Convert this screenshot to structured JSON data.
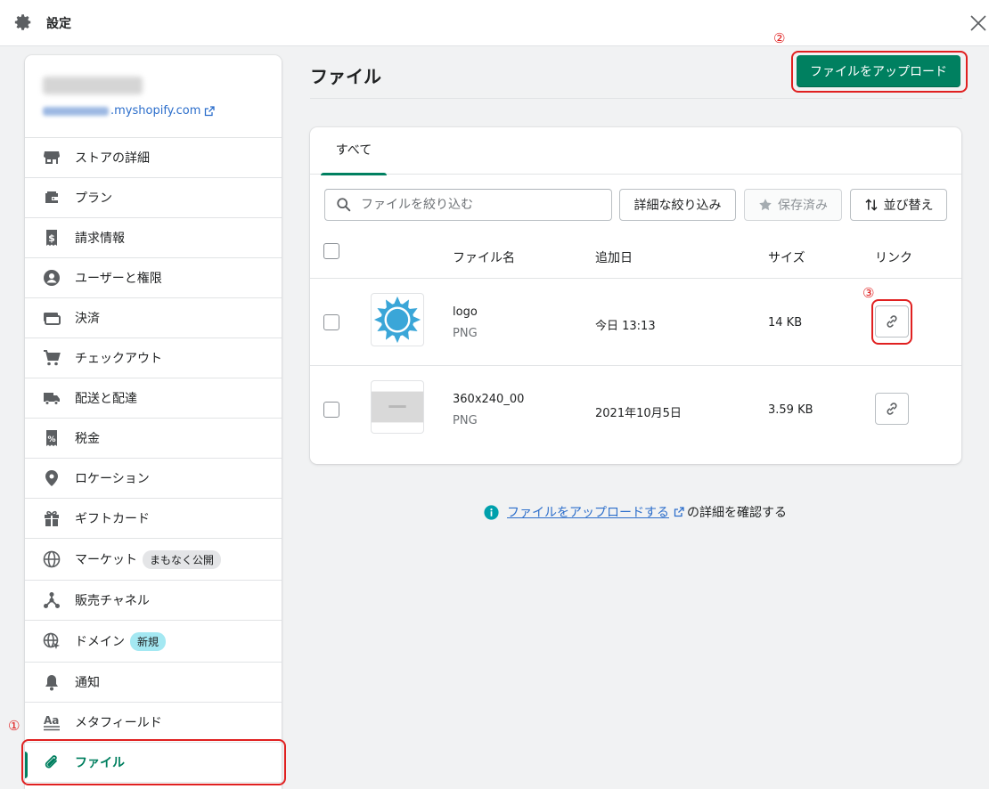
{
  "window": {
    "title": "設定"
  },
  "store": {
    "url_suffix": ".myshopify.com"
  },
  "sidebar": {
    "items": [
      {
        "label": "ストアの詳細",
        "icon": "store-icon"
      },
      {
        "label": "プラン",
        "icon": "plan-icon"
      },
      {
        "label": "請求情報",
        "icon": "billing-icon"
      },
      {
        "label": "ユーザーと権限",
        "icon": "user-icon"
      },
      {
        "label": "決済",
        "icon": "payment-icon"
      },
      {
        "label": "チェックアウト",
        "icon": "cart-icon"
      },
      {
        "label": "配送と配達",
        "icon": "truck-icon"
      },
      {
        "label": "税金",
        "icon": "tax-icon"
      },
      {
        "label": "ロケーション",
        "icon": "location-icon"
      },
      {
        "label": "ギフトカード",
        "icon": "gift-icon"
      },
      {
        "label": "マーケット",
        "icon": "globe-icon",
        "badge": "まもなく公開"
      },
      {
        "label": "販売チャネル",
        "icon": "channels-icon"
      },
      {
        "label": "ドメイン",
        "icon": "domain-icon",
        "badge": "新規"
      },
      {
        "label": "通知",
        "icon": "bell-icon"
      },
      {
        "label": "メタフィールド",
        "icon": "metafields-icon"
      },
      {
        "label": "ファイル",
        "icon": "paperclip-icon",
        "active": true
      }
    ]
  },
  "main": {
    "title": "ファイル",
    "upload_label": "ファイルをアップロード",
    "tabs": [
      {
        "label": "すべて"
      }
    ],
    "search_placeholder": "ファイルを絞り込む",
    "filter_label": "詳細な絞り込み",
    "saved_label": "保存済み",
    "sort_label": "並び替え",
    "columns": {
      "name": "ファイル名",
      "date": "追加日",
      "size": "サイズ",
      "link": "リンク"
    },
    "files": [
      {
        "name": "logo",
        "type": "PNG",
        "date": "今日 13:13",
        "size": "14 KB"
      },
      {
        "name": "360x240_00",
        "type": "PNG",
        "date": "2021年10月5日",
        "size": "3.59 KB"
      }
    ],
    "help": {
      "link_text": "ファイルをアップロードする",
      "suffix": "の詳細を確認する"
    }
  },
  "annotations": [
    "①",
    "②",
    "③"
  ],
  "colors": {
    "primary": "#008060",
    "active_text": "#007f5f",
    "link": "#2c6ecb",
    "annotation": "#e02020"
  }
}
